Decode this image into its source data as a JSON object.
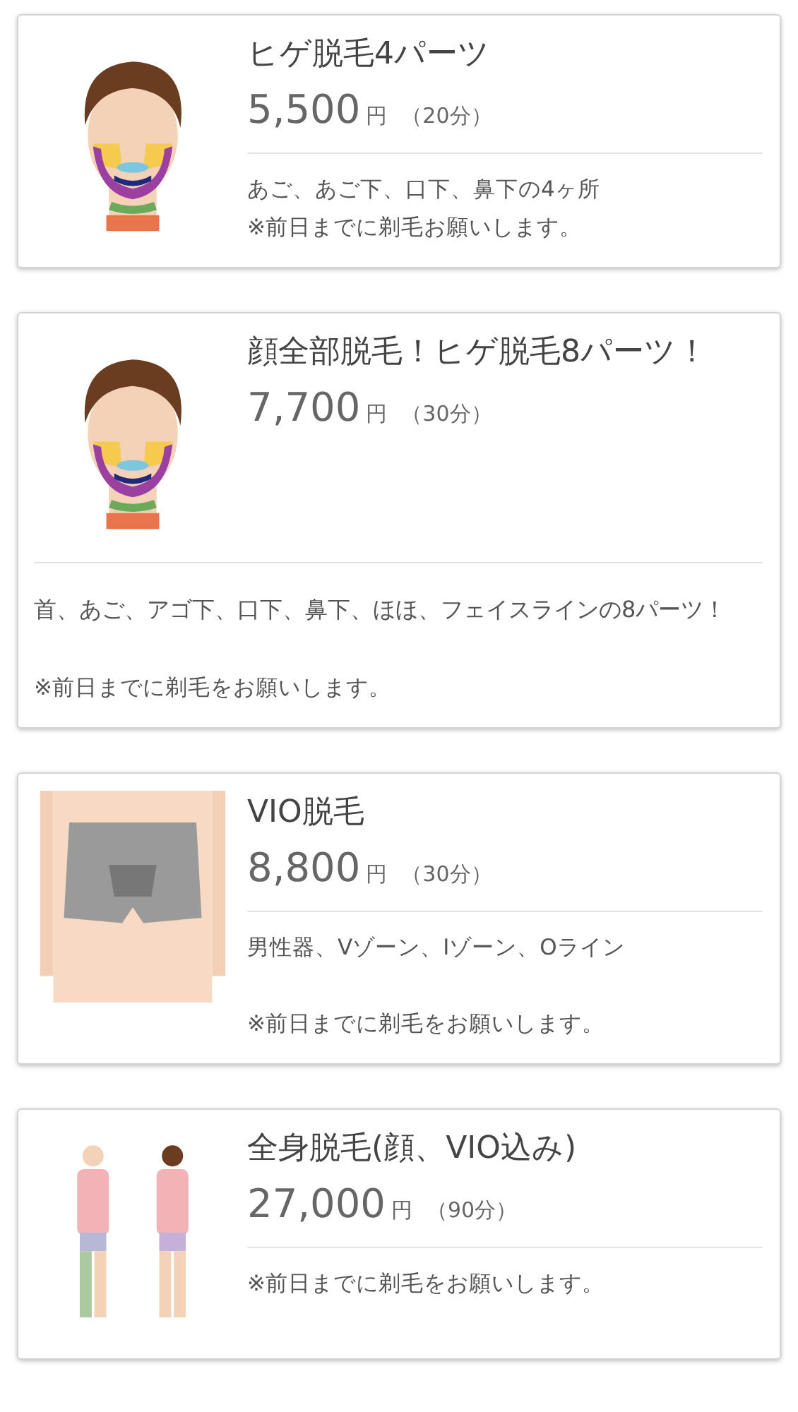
{
  "menu_items": [
    {
      "kind": "compact",
      "picture": {
        "kind": "face"
      },
      "title": "ヒゲ脱毛4パーツ",
      "price": "5,500",
      "currency": "円",
      "duration": "（20分）",
      "description": "あご、あご下、口下、鼻下の4ヶ所",
      "note": "※前日までに剃毛お願いします。"
    },
    {
      "kind": "below",
      "picture": {
        "kind": "face"
      },
      "title": "顔全部脱毛！ヒゲ脱毛8パーツ！",
      "price": "7,700",
      "currency": "円",
      "duration": "（30分）",
      "description": "首、あご、アゴ下、口下、鼻下、ほほ、フェイスラインの8パーツ！",
      "note": "※前日までに剃毛をお願いします。"
    },
    {
      "kind": "spaced",
      "picture": {
        "kind": "hips"
      },
      "title": "VIO脱毛",
      "price": "8,800",
      "currency": "円",
      "duration": "（30分）",
      "description": "男性器、Vゾーン、Iゾーン、Oライン",
      "note": "※前日までに剃毛をお願いします。"
    },
    {
      "kind": "compact",
      "picture": {
        "kind": "body"
      },
      "title": "全身脱毛(顔、VIO込み)",
      "price": "27,000",
      "currency": "円",
      "duration": "（90分）",
      "note": "※前日までに剃毛をお願いします。"
    }
  ]
}
